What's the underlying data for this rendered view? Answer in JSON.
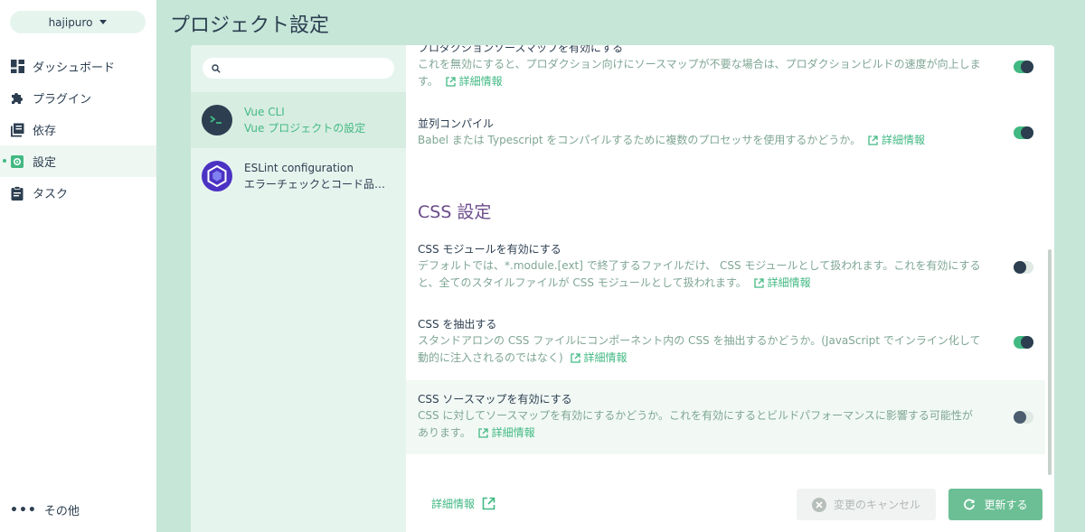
{
  "project": {
    "name": "hajipuro"
  },
  "sidebar": {
    "items": [
      {
        "label": "ダッシュボード",
        "icon": "dashboard-icon"
      },
      {
        "label": "プラグイン",
        "icon": "puzzle-icon"
      },
      {
        "label": "依存",
        "icon": "library-icon"
      },
      {
        "label": "設定",
        "icon": "settings-icon",
        "active": true
      },
      {
        "label": "タスク",
        "icon": "clipboard-icon"
      }
    ],
    "more_label": "その他"
  },
  "page": {
    "title": "プロジェクト設定"
  },
  "search": {
    "placeholder": ""
  },
  "plugins": [
    {
      "name": "Vue CLI",
      "description": "Vue プロジェクトの設定",
      "selected": true
    },
    {
      "name": "ESLint configuration",
      "description": "エラーチェックとコード品…",
      "selected": false
    }
  ],
  "options": {
    "prod_sourcemap": {
      "title": "プロダクションソースマップを有効にする",
      "description": "これを無効にすると、プロダクション向けにソースマップが不要な場合は、プロダクションビルドの速度が向上します。",
      "link": "詳細情報",
      "enabled": true
    },
    "parallel": {
      "title": "並列コンパイル",
      "description": "Babel または Typescript をコンパイルするために複数のプロセッサを使用するかどうか。",
      "link": "詳細情報",
      "enabled": true
    },
    "css_section_title": "CSS 設定",
    "css_modules": {
      "title": "CSS モジュールを有効にする",
      "description": "デフォルトでは、*.module.[ext] で終了するファイルだけ、 CSS モジュールとして扱われます。これを有効にすると、全てのスタイルファイルが CSS モジュールとして扱われます。",
      "link": "詳細情報",
      "enabled": false
    },
    "css_extract": {
      "title": "CSS を抽出する",
      "description": "スタンドアロンの CSS ファイルにコンポーネント内の CSS を抽出するかどうか。(JavaScript でインライン化して動的に注入されるのではなく)",
      "link": "詳細情報",
      "enabled": true
    },
    "css_sourcemap": {
      "title": "CSS ソースマップを有効にする",
      "description": "CSS に対してソースマップを有効にするかどうか。これを有効にするとビルドパフォーマンスに影響する可能性があります。",
      "link": "詳細情報",
      "enabled": false
    }
  },
  "footer": {
    "more_info": "詳細情報",
    "cancel_label": "変更のキャンセル",
    "refresh_label": "更新する"
  },
  "colors": {
    "accent": "#42b983",
    "background": "#c6e6d8",
    "section_title": "#6b4b8a"
  }
}
